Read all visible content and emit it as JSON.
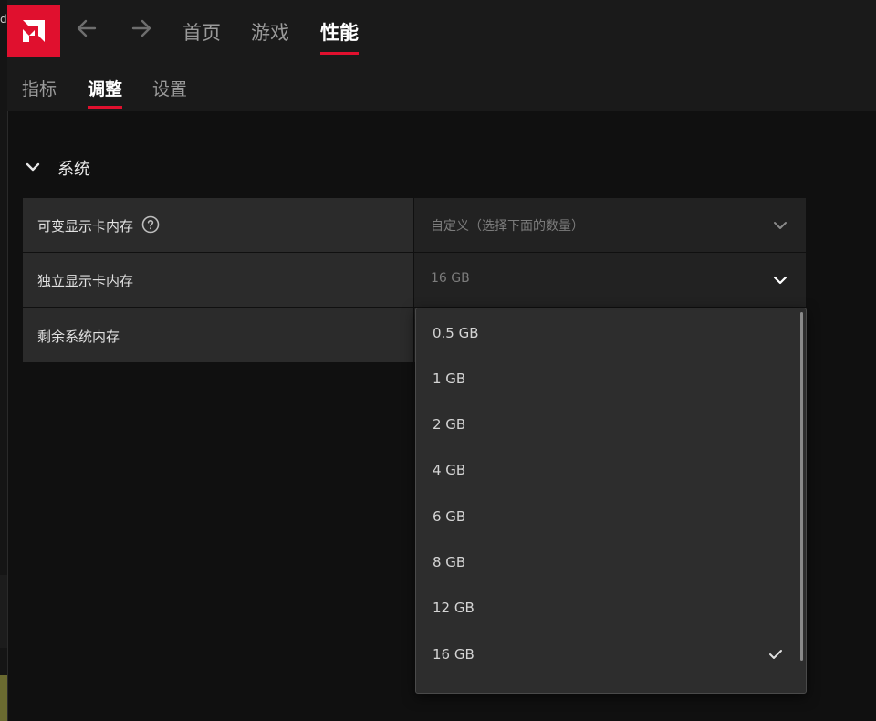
{
  "window": {
    "edge_fragment": "d"
  },
  "nav": {
    "tabs": [
      {
        "label": "首页",
        "active": false
      },
      {
        "label": "游戏",
        "active": false
      },
      {
        "label": "性能",
        "active": true
      }
    ]
  },
  "subnav": {
    "tabs": [
      {
        "label": "指标",
        "active": false
      },
      {
        "label": "调整",
        "active": true
      },
      {
        "label": "设置",
        "active": false
      }
    ]
  },
  "section": {
    "title": "系统",
    "expanded": true
  },
  "rows": [
    {
      "label": "可变显示卡内存",
      "value": "自定义（选择下面的数量）"
    },
    {
      "label": "独立显示卡内存",
      "value": "16 GB"
    },
    {
      "label": "剩余系统内存",
      "value": ""
    }
  ],
  "dropdown": {
    "options": [
      "0.5 GB",
      "1 GB",
      "2 GB",
      "4 GB",
      "6 GB",
      "8 GB",
      "12 GB",
      "16 GB"
    ],
    "selected": "16 GB"
  },
  "colors": {
    "accent": "#e0102e",
    "background": "#101010",
    "panel": "#2b2b2b"
  },
  "icons": [
    "amd-logo-icon",
    "arrow-left-icon",
    "arrow-right-icon",
    "chevron-down-icon",
    "help-icon",
    "check-icon"
  ]
}
